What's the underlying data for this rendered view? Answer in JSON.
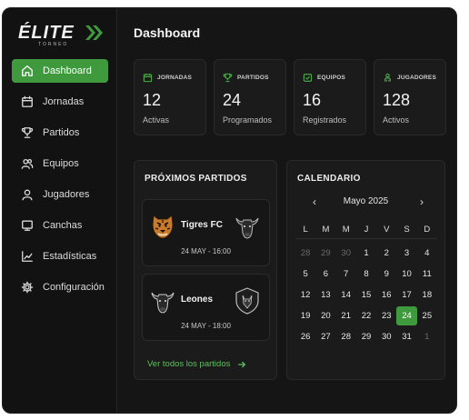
{
  "brand": {
    "name": "ÉLITE",
    "sub": "TORNEO",
    "accent": "#3e9a3c"
  },
  "page": {
    "title": "Dashboard"
  },
  "sidebar": {
    "items": [
      {
        "label": "Dashboard",
        "icon": "home-icon",
        "active": true
      },
      {
        "label": "Jornadas",
        "icon": "calendar-icon",
        "active": false
      },
      {
        "label": "Partidos",
        "icon": "trophy-icon",
        "active": false
      },
      {
        "label": "Equipos",
        "icon": "users-icon",
        "active": false
      },
      {
        "label": "Jugadores",
        "icon": "user-icon",
        "active": false
      },
      {
        "label": "Canchas",
        "icon": "monitor-icon",
        "active": false
      },
      {
        "label": "Estadísticas",
        "icon": "chart-icon",
        "active": false
      },
      {
        "label": "Configuración",
        "icon": "gear-icon",
        "active": false
      }
    ]
  },
  "stats": [
    {
      "label": "JORNADAS",
      "value": "12",
      "sub": "Activas",
      "icon": "calendar-icon"
    },
    {
      "label": "PARTIDOS",
      "value": "24",
      "sub": "Programados",
      "icon": "trophy-icon"
    },
    {
      "label": "EQUIPOS",
      "value": "16",
      "sub": "Registrados",
      "icon": "shield-check-icon"
    },
    {
      "label": "JUGADORES",
      "value": "128",
      "sub": "Activos",
      "icon": "player-icon"
    }
  ],
  "upcoming": {
    "title": "PRÓXIMOS PARTIDOS",
    "matches": [
      {
        "team": "Tigres FC",
        "date": "24 MAY - 16:00",
        "home_crest": "tiger-crest-icon",
        "away_crest": "bull-crest-icon"
      },
      {
        "team": "Leones",
        "date": "24 MAY - 18:00",
        "home_crest": "bull-crest-icon",
        "away_crest": "wolf-shield-crest-icon"
      }
    ],
    "see_all": "Ver todos los partidos"
  },
  "calendar": {
    "title": "CALENDARIO",
    "month": "Mayo 2025",
    "weekdays": [
      "L",
      "M",
      "M",
      "J",
      "V",
      "S",
      "D"
    ],
    "weeks": [
      [
        "28",
        "29",
        "30",
        "1",
        "2",
        "3",
        "4"
      ],
      [
        "5",
        "6",
        "7",
        "8",
        "9",
        "10",
        "11"
      ],
      [
        "12",
        "13",
        "14",
        "15",
        "16",
        "17",
        "18"
      ],
      [
        "19",
        "20",
        "21",
        "22",
        "23",
        "24",
        "25"
      ],
      [
        "26",
        "27",
        "28",
        "29",
        "30",
        "31",
        "1"
      ]
    ],
    "today": "24"
  }
}
